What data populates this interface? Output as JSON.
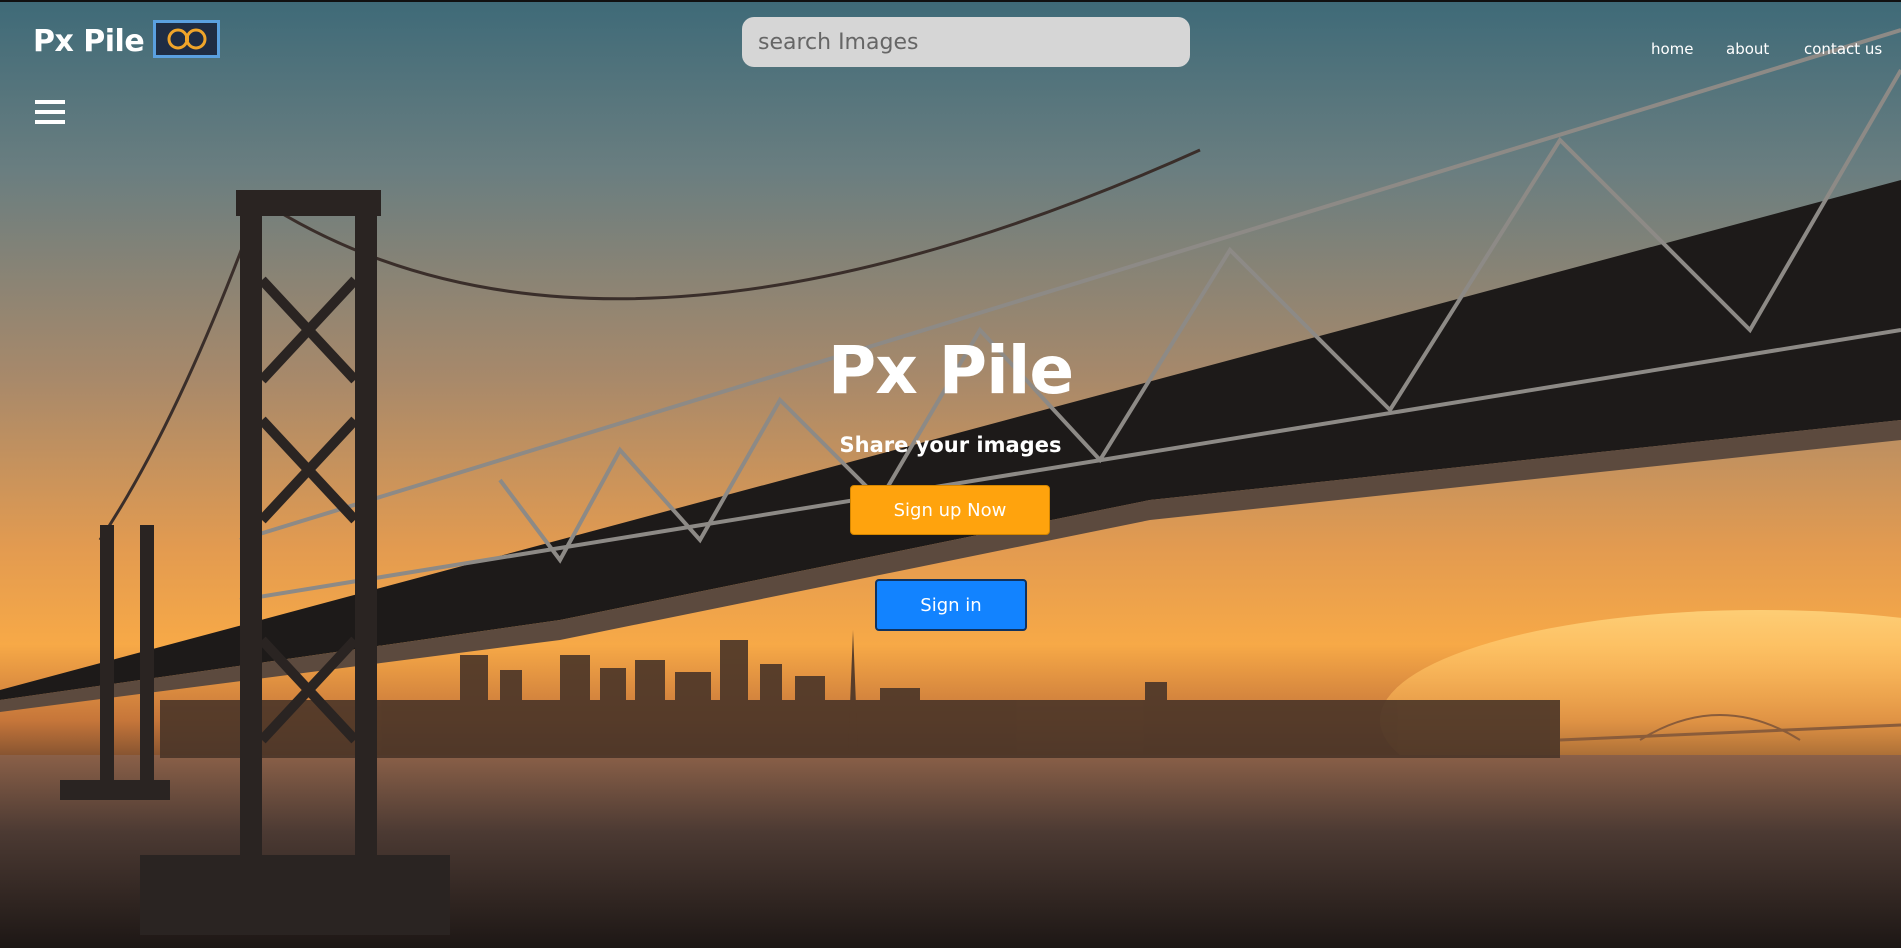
{
  "header": {
    "brand": "Px Pile",
    "search": {
      "placeholder": "search Images",
      "value": ""
    },
    "nav": [
      {
        "label": "home"
      },
      {
        "label": "about"
      },
      {
        "label": "contact us"
      }
    ]
  },
  "hero": {
    "title": "Px Pile",
    "subtitle": "Share your images",
    "signup_label": "Sign up Now",
    "signin_label": "Sign in",
    "background": "bridge-at-sunset-photo"
  },
  "icons": {
    "logo": "binoculars-icon",
    "menu": "hamburger-menu-icon"
  },
  "colors": {
    "signup_button": "#ffa30d",
    "signin_button": "#1283ff",
    "search_bg": "#d6d6d6",
    "logo_border": "#5aa0e0"
  }
}
